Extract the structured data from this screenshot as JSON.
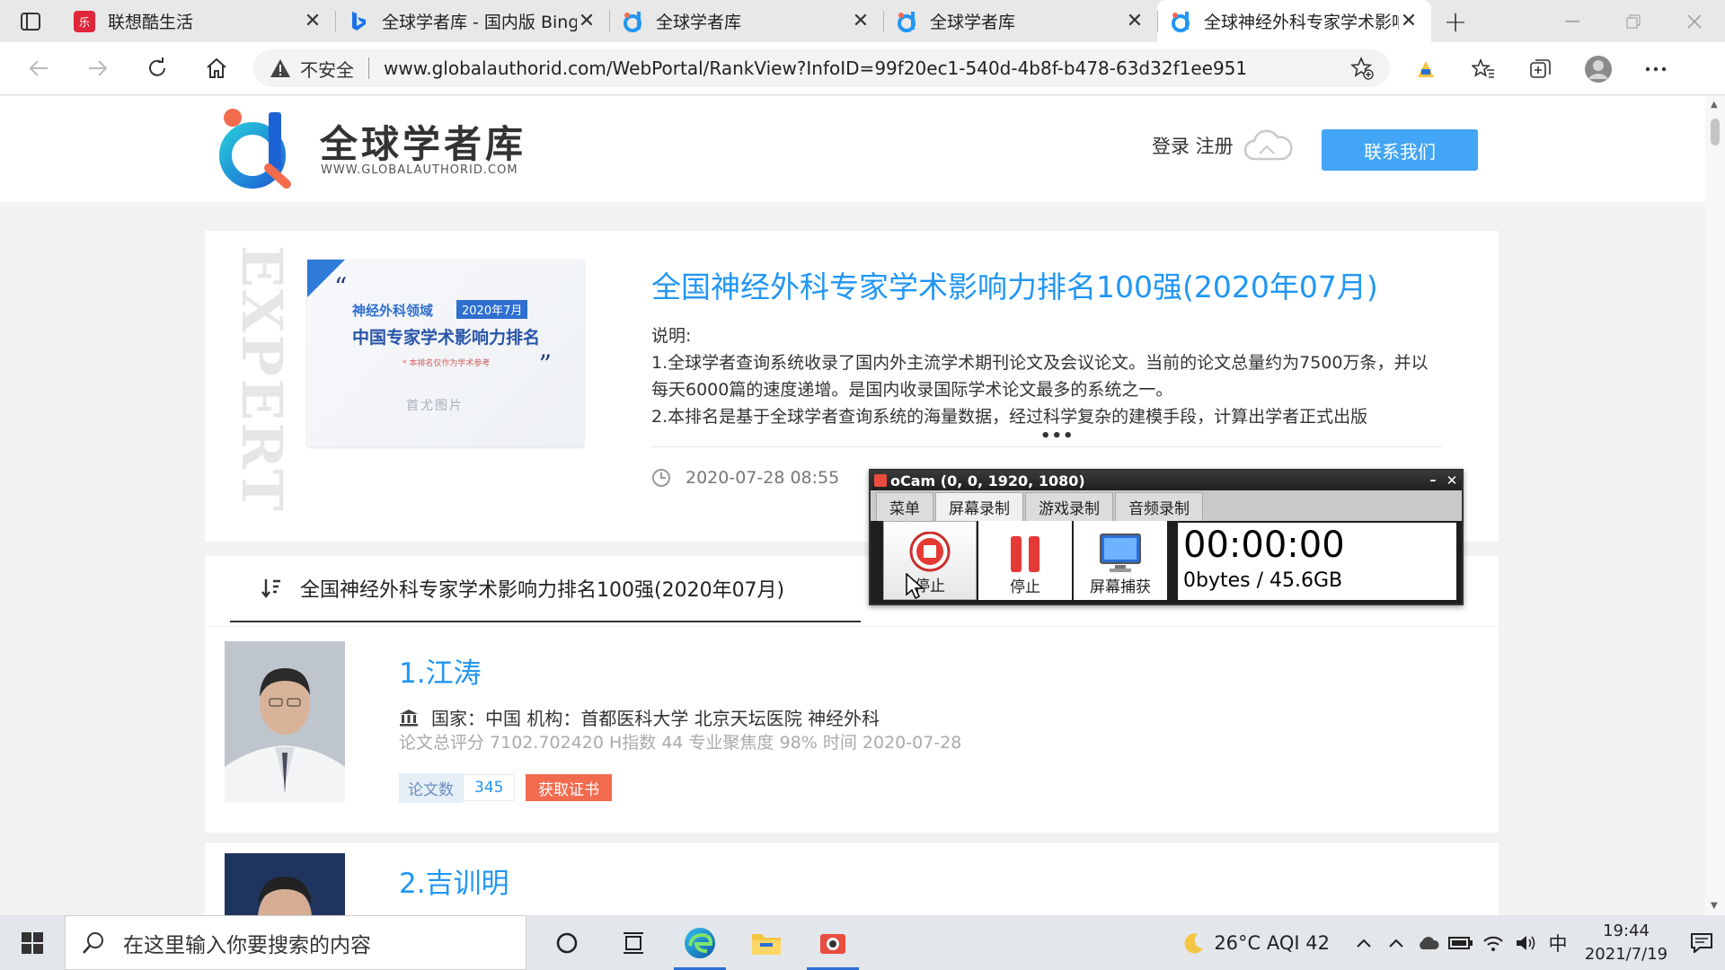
{
  "browser": {
    "tabs": [
      {
        "title": "联想酷生活",
        "close": "✕",
        "active": false
      },
      {
        "title": "全球学者库 - 国内版 Bing",
        "close": "✕",
        "active": false
      },
      {
        "title": "全球学者库",
        "close": "✕",
        "active": false
      },
      {
        "title": "全球学者库",
        "close": "✕",
        "active": false
      },
      {
        "title": "全球神经外科专家学术影响",
        "close": "✕",
        "active": true
      }
    ],
    "new_tab": "+",
    "security_label": "不安全",
    "url": "www.globalauthorid.com/WebPortal/RankView?InfoID=99f20ec1-540d-4b8f-b478-63d32f1ee951"
  },
  "site": {
    "logo_title": "全球学者库",
    "logo_subtitle": "WWW.GLOBALAUTHORID.COM",
    "login_register": "登录 注册",
    "contact_button": "联系我们"
  },
  "article": {
    "decor_word": "EXPERT",
    "cover": {
      "line1": "神经外科领域",
      "badge": "2020年7月",
      "line2": "中国专家学术影响力排名",
      "line3": "* 本排名仅作为学术参考",
      "line4": "首尤图片"
    },
    "title": "全国神经外科专家学术影响力排名100强(2020年07月)",
    "desc_label": "说明:",
    "desc_lines": [
      "1.全球学者查询系统收录了国内外主流学术期刊论文及会议论文。当前的论文总量约为7500万条，并以每天6000篇的速度递增。是国内收录国际学术论文最多的系统之一。",
      "2.本排名是基于全球学者查询系统的海量数据，经过科学复杂的建模手段，计算出学者正式出版"
    ],
    "more": "•••",
    "date": "2020-07-28 08:55"
  },
  "ranking": {
    "header": "全国神经外科专家学术影响力排名100强(2020年07月)",
    "rows": [
      {
        "name": "1.江涛",
        "institution": "国家：中国 机构：首都医科大学 北京天坛医院 神经外科",
        "stats": "论文总评分 7102.702420 H指数 44 专业聚焦度 98% 时间 2020-07-28",
        "papers_label": "论文数",
        "papers_count": "345",
        "cert_button": "获取证书"
      },
      {
        "name": "2.吉训明"
      }
    ]
  },
  "ocam": {
    "title": "oCam (0, 0, 1920, 1080)",
    "min": "–",
    "close": "✕",
    "tabs": [
      "菜单",
      "屏幕录制",
      "游戏录制",
      "音频录制"
    ],
    "selected_tab": "屏幕录制",
    "record_button": "停止",
    "pause_button": "停止",
    "capture_button": "屏幕捕获",
    "timer": "00:00:00",
    "size": "0bytes / 45.6GB"
  },
  "taskbar": {
    "search_placeholder": "在这里输入你要搜索的内容",
    "weather": "26°C AQI 42",
    "ime": "中",
    "time": "19:44",
    "date": "2021/7/19"
  },
  "colors": {
    "accent_blue": "#2196f3",
    "contact_blue": "#42a5f5",
    "cert_red": "#f26b4f"
  }
}
